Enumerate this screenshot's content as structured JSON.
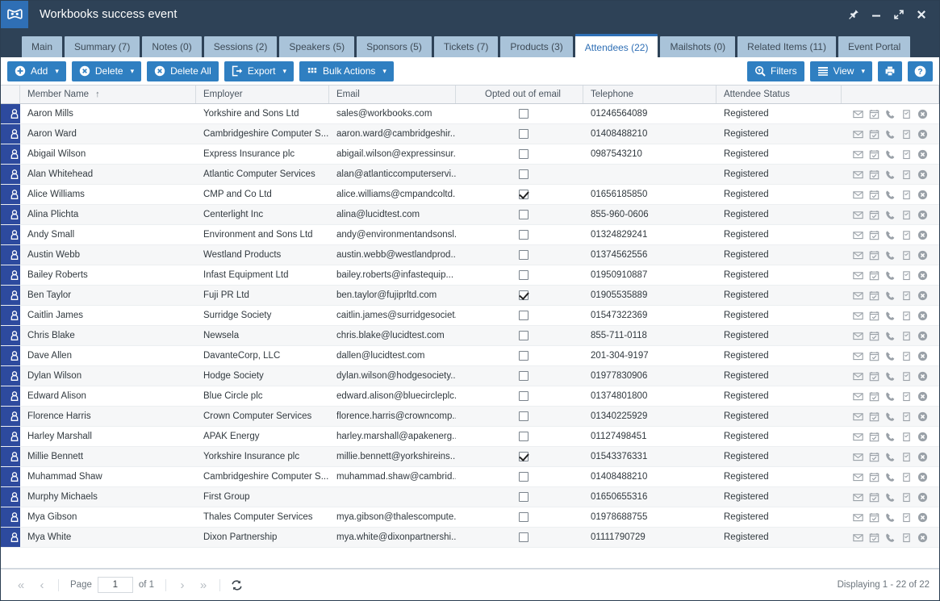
{
  "window": {
    "title": "Workbooks success event",
    "logo_icon": "workbooks-logo-icon",
    "controls": [
      {
        "name": "pin-icon",
        "label": "Pin"
      },
      {
        "name": "minimize-icon",
        "label": "Minimize"
      },
      {
        "name": "maximize-icon",
        "label": "Maximize"
      },
      {
        "name": "close-icon",
        "label": "Close"
      }
    ]
  },
  "tabs": [
    {
      "label": "Main",
      "active": false
    },
    {
      "label": "Summary (7)",
      "active": false
    },
    {
      "label": "Notes (0)",
      "active": false
    },
    {
      "label": "Sessions (2)",
      "active": false
    },
    {
      "label": "Speakers (5)",
      "active": false
    },
    {
      "label": "Sponsors (5)",
      "active": false
    },
    {
      "label": "Tickets (7)",
      "active": false
    },
    {
      "label": "Products (3)",
      "active": false
    },
    {
      "label": "Attendees (22)",
      "active": true
    },
    {
      "label": "Mailshots (0)",
      "active": false
    },
    {
      "label": "Related Items (11)",
      "active": false
    },
    {
      "label": "Event Portal",
      "active": false
    }
  ],
  "toolbar": {
    "left": [
      {
        "label": "Add",
        "icon": "plus-circle-icon",
        "caret": true
      },
      {
        "label": "Delete",
        "icon": "x-circle-icon",
        "caret": true
      },
      {
        "label": "Delete All",
        "icon": "x-circle-icon",
        "caret": false
      },
      {
        "label": "Export",
        "icon": "export-arrow-icon",
        "caret": true
      },
      {
        "label": "Bulk Actions",
        "icon": "grid-squares-icon",
        "caret": true
      }
    ],
    "right": [
      {
        "label": "Filters",
        "icon": "filter-magnifier-icon",
        "caret": false
      },
      {
        "label": "View",
        "icon": "list-lines-icon",
        "caret": true
      },
      {
        "label": "",
        "icon": "printer-icon",
        "caret": false
      },
      {
        "label": "",
        "icon": "help-question-icon",
        "caret": false
      }
    ],
    "accent_color": "#2f7fc1"
  },
  "grid": {
    "columns": [
      {
        "label": "",
        "key": "icon"
      },
      {
        "label": "Member Name",
        "key": "name",
        "sort": "ascending",
        "sort_glyph": "↑"
      },
      {
        "label": "Employer",
        "key": "employer"
      },
      {
        "label": "Email",
        "key": "email"
      },
      {
        "label": "Opted out of email",
        "key": "opted_out"
      },
      {
        "label": "Telephone",
        "key": "telephone"
      },
      {
        "label": "Attendee Status",
        "key": "status"
      },
      {
        "label": "",
        "key": "actions"
      }
    ],
    "row_actions": [
      "email-icon",
      "calendar-icon",
      "phone-icon",
      "task-icon",
      "delete-circle-icon"
    ],
    "row_icon": "person-icon",
    "rows": [
      {
        "name": "Aaron Mills",
        "employer": "Yorkshire and Sons Ltd",
        "email": "sales@workbooks.com",
        "opted_out": false,
        "telephone": "01246564089",
        "status": "Registered"
      },
      {
        "name": "Aaron Ward",
        "employer": "Cambridgeshire Computer S...",
        "email": "aaron.ward@cambridgeshir...",
        "opted_out": false,
        "telephone": "01408488210",
        "status": "Registered"
      },
      {
        "name": "Abigail Wilson",
        "employer": "Express Insurance plc",
        "email": "abigail.wilson@expressinsur...",
        "opted_out": false,
        "telephone": "0987543210",
        "status": "Registered"
      },
      {
        "name": "Alan Whitehead",
        "employer": "Atlantic Computer Services",
        "email": "alan@atlanticcomputerservi...",
        "opted_out": false,
        "telephone": "",
        "status": "Registered"
      },
      {
        "name": "Alice Williams",
        "employer": "CMP and Co Ltd",
        "email": "alice.williams@cmpandcoltd....",
        "opted_out": true,
        "telephone": "01656185850",
        "status": "Registered"
      },
      {
        "name": "Alina Plichta",
        "employer": "Centerlight Inc",
        "email": "alina@lucidtest.com",
        "opted_out": false,
        "telephone": "855-960-0606",
        "status": "Registered"
      },
      {
        "name": "Andy Small",
        "employer": "Environment and Sons Ltd",
        "email": "andy@environmentandsonsl...",
        "opted_out": false,
        "telephone": "01324829241",
        "status": "Registered"
      },
      {
        "name": "Austin Webb",
        "employer": "Westland Products",
        "email": "austin.webb@westlandprod...",
        "opted_out": false,
        "telephone": "01374562556",
        "status": "Registered"
      },
      {
        "name": "Bailey Roberts",
        "employer": "Infast Equipment Ltd",
        "email": "bailey.roberts@infastequip...",
        "opted_out": false,
        "telephone": "01950910887",
        "status": "Registered"
      },
      {
        "name": "Ben Taylor",
        "employer": "Fuji PR Ltd",
        "email": "ben.taylor@fujiprltd.com",
        "opted_out": true,
        "telephone": "01905535889",
        "status": "Registered"
      },
      {
        "name": "Caitlin James",
        "employer": "Surridge Society",
        "email": "caitlin.james@surridgesociet...",
        "opted_out": false,
        "telephone": "01547322369",
        "status": "Registered"
      },
      {
        "name": "Chris Blake",
        "employer": "Newsela",
        "email": "chris.blake@lucidtest.com",
        "opted_out": false,
        "telephone": "855-711-0118",
        "status": "Registered"
      },
      {
        "name": "Dave Allen",
        "employer": "DavanteCorp, LLC",
        "email": "dallen@lucidtest.com",
        "opted_out": false,
        "telephone": "201-304-9197",
        "status": "Registered"
      },
      {
        "name": "Dylan Wilson",
        "employer": "Hodge Society",
        "email": "dylan.wilson@hodgesociety....",
        "opted_out": false,
        "telephone": "01977830906",
        "status": "Registered"
      },
      {
        "name": "Edward Alison",
        "employer": "Blue Circle plc",
        "email": "edward.alison@bluecircleplc...",
        "opted_out": false,
        "telephone": "01374801800",
        "status": "Registered"
      },
      {
        "name": "Florence Harris",
        "employer": "Crown Computer Services",
        "email": "florence.harris@crowncomp...",
        "opted_out": false,
        "telephone": "01340225929",
        "status": "Registered"
      },
      {
        "name": "Harley Marshall",
        "employer": "APAK Energy",
        "email": "harley.marshall@apakenerg...",
        "opted_out": false,
        "telephone": "01127498451",
        "status": "Registered"
      },
      {
        "name": "Millie Bennett",
        "employer": "Yorkshire Insurance plc",
        "email": "millie.bennett@yorkshireins...",
        "opted_out": true,
        "telephone": "01543376331",
        "status": "Registered"
      },
      {
        "name": "Muhammad Shaw",
        "employer": "Cambridgeshire Computer S...",
        "email": "muhammad.shaw@cambrid...",
        "opted_out": false,
        "telephone": "01408488210",
        "status": "Registered"
      },
      {
        "name": "Murphy Michaels",
        "employer": "First Group",
        "email": "",
        "opted_out": false,
        "telephone": "01650655316",
        "status": "Registered"
      },
      {
        "name": "Mya Gibson",
        "employer": "Thales Computer Services",
        "email": "mya.gibson@thalescompute...",
        "opted_out": false,
        "telephone": "01978688755",
        "status": "Registered"
      },
      {
        "name": "Mya White",
        "employer": "Dixon Partnership",
        "email": "mya.white@dixonpartnershi...",
        "opted_out": false,
        "telephone": "01111790729",
        "status": "Registered"
      }
    ]
  },
  "footer": {
    "first_glyph": "«",
    "prev_glyph": "‹",
    "page_label": "Page",
    "page_value": "1",
    "of_label": "of 1",
    "next_glyph": "›",
    "last_glyph": "»",
    "refresh_icon": "refresh-icon",
    "displaying": "Displaying 1 - 22 of 22"
  }
}
